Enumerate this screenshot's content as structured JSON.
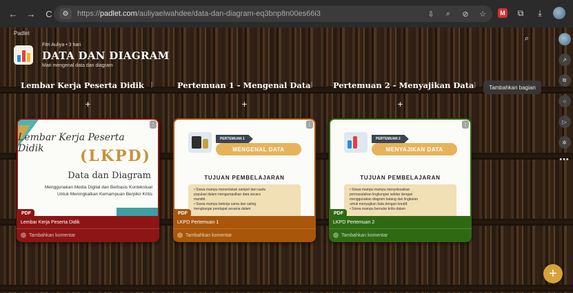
{
  "browser": {
    "url_prefix": "https://",
    "url_host": "padlet.com",
    "url_path": "/auliyaelwahdee/data-dan-diagram-eq3bnp8n00es66i3",
    "back_icon": "←",
    "forward_icon": "→",
    "reload_icon": "C",
    "site_info_icon": "⚙",
    "extension_icons": [
      "install-icon",
      "zoom-icon",
      "eye-off-icon",
      "star-icon"
    ]
  },
  "board": {
    "brand": "Padlet",
    "author": "Fitri Auliya • 3 hari",
    "title": "DATA DAN DIAGRAM",
    "description": "Mari mengenal data dan diagram",
    "add_section_label": "Tambahkan bagian",
    "fab_label": "+"
  },
  "columns": [
    {
      "title": "Lembar Kerja Peserta Didik",
      "add_label": "+",
      "card": {
        "color": "#8e1515",
        "file_tag": "PDF",
        "name": "Lembar Kerja Peserta Didik",
        "comment_label": "Tambahkan komentar",
        "thumb": {
          "heading": "Lembar Kerja Peserta Didik",
          "big": "(LKPD)",
          "sub": "Data dan Diagram",
          "desc1": "Menggunakan Media Digital dan Berbasis Kontekstual",
          "desc2": "Untuk Meningkatkan Kemampuan Berpikir Kritis"
        }
      }
    },
    {
      "title": "Pertemuan 1 - Mengenal Data",
      "add_label": "+",
      "card": {
        "color": "#a9560a",
        "file_tag": "PDF",
        "name": "LKPD Pertemuan 1",
        "comment_label": "Tambahkan komentar",
        "thumb": {
          "label1": "PERTEMUAN 1",
          "label2": "MENGENAL DATA",
          "heading": "TUJUAN PEMBELAJARAN",
          "lines": [
            "• Siswa mampu menentukan sampel dari suatu",
            "populasi dalam mengumpulkan data secara",
            "mandiri.",
            "• Siswa mampu bekerja sama dan saling",
            "menghargai pendapat sesama dalam"
          ]
        }
      }
    },
    {
      "title": "Pertemuan 2 - Menyajikan Data",
      "add_label": "+",
      "card": {
        "color": "#2f6a12",
        "file_tag": "PDF",
        "name": "LKPD Pertemuan 2",
        "comment_label": "Tambahkan komentar",
        "thumb": {
          "label1": "PERTEMUAN 2",
          "label2": "MENYAJIKAN DATA",
          "heading": "TUJUAN PEMBELAJARAN",
          "lines": [
            "• Siswa mampu mampu menyelesaikan",
            "permasalahan lingkungan sekitar dengan",
            "menggunakan diagram batang dan lingkaran",
            "untuk menyajikan data dengan kreatif.",
            "• Siswa mampu bernalar kritis dalam"
          ]
        }
      }
    }
  ]
}
